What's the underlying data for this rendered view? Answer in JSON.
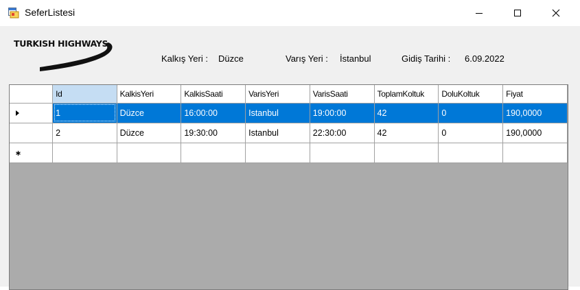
{
  "window": {
    "title": "SeferListesi",
    "icons": {
      "app": "form-icon",
      "minimize": "minimize-icon",
      "maximize": "maximize-icon",
      "close": "close-icon"
    }
  },
  "logo": {
    "text": "TURKISH HIGHWAYS"
  },
  "info": {
    "departure_label": "Kalkış Yeri :",
    "departure_value": "Düzce",
    "arrival_label": "Varış Yeri :",
    "arrival_value": "İstanbul",
    "date_label": "Gidiş Tarihi :",
    "date_value": "6.09.2022"
  },
  "grid": {
    "columns": [
      "Id",
      "KalkisYeri",
      "KalkisSaati",
      "VarisYeri",
      "VarisSaati",
      "ToplamKoltuk",
      "DoluKoltuk",
      "Fiyat"
    ],
    "rows": [
      {
        "selected": true,
        "cells": [
          "1",
          "Düzce",
          "16:00:00",
          "Istanbul",
          "19:00:00",
          "42",
          "0",
          "190,0000"
        ]
      },
      {
        "selected": false,
        "cells": [
          "2",
          "Düzce",
          "19:30:00",
          "Istanbul",
          "22:30:00",
          "42",
          "0",
          "190,0000"
        ]
      }
    ],
    "row_header_icons": {
      "current": "current-row-arrow-icon",
      "new": "new-row-star-icon"
    },
    "colors": {
      "selection": "#0078d7",
      "sorted_header": "#c5ddf3",
      "background": "#ababab"
    }
  }
}
